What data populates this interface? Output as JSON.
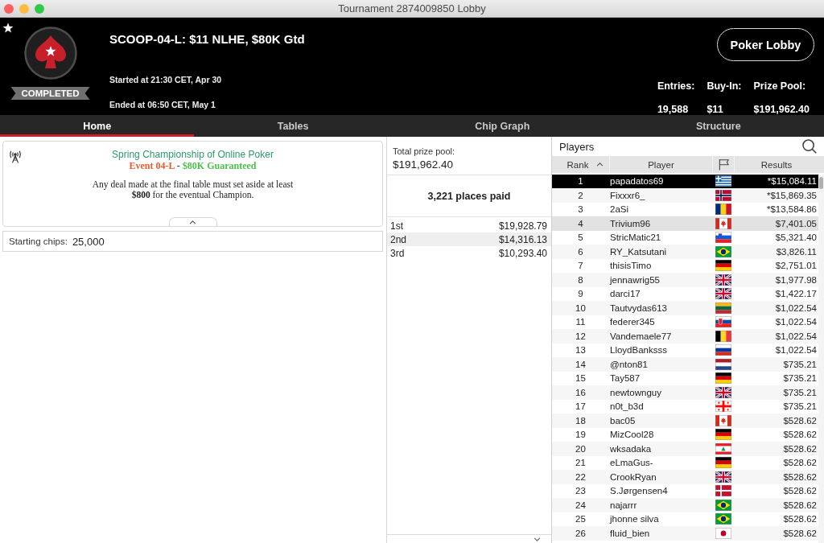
{
  "window": {
    "title": "Tournament 2874009850 Lobby"
  },
  "header": {
    "status": "COMPLETED",
    "title": "SCOOP-04-L: $11 NLHE, $80K Gtd",
    "started": "Started at 21:30 CET, Apr 30",
    "ended": "Ended at 06:50 CET, May 1",
    "lobby_button": "Poker Lobby",
    "stats": [
      {
        "label": "Entries:",
        "value": "19,588"
      },
      {
        "label": "Buy-In:",
        "value": "$11"
      },
      {
        "label": "Prize Pool:",
        "value": "$191,962.40"
      }
    ]
  },
  "tabs": [
    {
      "label": "Home",
      "selected": true
    },
    {
      "label": "Tables",
      "selected": false
    },
    {
      "label": "Chip Graph",
      "selected": false
    },
    {
      "label": "Structure",
      "selected": false
    }
  ],
  "home": {
    "announcement": {
      "heading": "Spring Championship of Online Poker",
      "event_line": [
        {
          "text": "Event 04-L",
          "color": "#ef5b2b"
        },
        {
          "text": "-"
        },
        {
          "text": "$80K Guaranteed",
          "color": "#4cc24c"
        }
      ],
      "body": "Any deal made at the final table must set aside at least **$800** for the eventual Champion.",
      "expanded": true
    },
    "starting_chips": {
      "label": "Starting chips:",
      "value": "25,000"
    }
  },
  "prize_pool": {
    "total_label": "Total prize pool:",
    "total": "$191,962.40",
    "places_paid": "3,221 places paid",
    "rows": [
      {
        "place": "1st",
        "amount": "$19,928.79"
      },
      {
        "place": "2nd",
        "amount": "$14,316.13"
      },
      {
        "place": "3rd",
        "amount": "$10,293.40"
      }
    ]
  },
  "players": {
    "title": "Players",
    "columns": [
      {
        "kind": "text",
        "label": "Rank",
        "sorted": true
      },
      {
        "kind": "text",
        "label": "Player",
        "sorted": false
      },
      {
        "kind": "flag",
        "sorted": false
      },
      {
        "kind": "text",
        "label": "Results",
        "sorted": false
      }
    ],
    "rows": [
      {
        "rank": "1",
        "player": "papadatos69",
        "kind": "greece",
        "result": "*$15,084.11",
        "selected": true,
        "highlighted": false
      },
      {
        "rank": "2",
        "player": "Fixxxr6_",
        "kind": "norway",
        "result": "*$15,869.35",
        "selected": false,
        "highlighted": false
      },
      {
        "rank": "3",
        "player": "2aSi",
        "kind": "romania",
        "result": "*$13,584.86",
        "selected": false,
        "highlighted": false
      },
      {
        "rank": "4",
        "player": "Trivium96",
        "kind": "canada",
        "result": "$7,401.05",
        "selected": false,
        "highlighted": true
      },
      {
        "rank": "5",
        "player": "StricMatic21",
        "kind": "slovenia",
        "result": "$5,321.40",
        "selected": false,
        "highlighted": false
      },
      {
        "rank": "6",
        "player": "RY_Katsutani",
        "kind": "brazil",
        "result": "$3,826.11",
        "selected": false,
        "highlighted": false
      },
      {
        "rank": "7",
        "player": "thisisTimo",
        "kind": "germany",
        "result": "$2,751.01",
        "selected": false,
        "highlighted": false
      },
      {
        "rank": "8",
        "player": "jennawrig55",
        "kind": "uk",
        "result": "$1,977.98",
        "selected": false,
        "highlighted": false
      },
      {
        "rank": "9",
        "player": "darci17",
        "kind": "uk",
        "result": "$1,422.17",
        "selected": false,
        "highlighted": false
      },
      {
        "rank": "10",
        "player": "Tautvydas613",
        "kind": "lithuania",
        "result": "$1,022.54",
        "selected": false,
        "highlighted": false
      },
      {
        "rank": "11",
        "player": "federer345",
        "kind": "slovakia",
        "result": "$1,022.54",
        "selected": false,
        "highlighted": false
      },
      {
        "rank": "12",
        "player": "Vandemaele77",
        "kind": "belgium",
        "result": "$1,022.54",
        "selected": false,
        "highlighted": false
      },
      {
        "rank": "13",
        "player": "LloydBanksss",
        "kind": "russia",
        "result": "$1,022.54",
        "selected": false,
        "highlighted": false
      },
      {
        "rank": "14",
        "player": "@nton81",
        "kind": "netherlands",
        "result": "$735.21",
        "selected": false,
        "highlighted": false
      },
      {
        "rank": "15",
        "player": "Tay587",
        "kind": "germany",
        "result": "$735.21",
        "selected": false,
        "highlighted": false
      },
      {
        "rank": "16",
        "player": "newtownguy",
        "kind": "uk",
        "result": "$735.21",
        "selected": false,
        "highlighted": false
      },
      {
        "rank": "17",
        "player": "n0t_b3d",
        "kind": "georgia",
        "result": "$735.21",
        "selected": false,
        "highlighted": false
      },
      {
        "rank": "18",
        "player": "bac05",
        "kind": "canada",
        "result": "$528.62",
        "selected": false,
        "highlighted": false
      },
      {
        "rank": "19",
        "player": "MizCool28",
        "kind": "germany",
        "result": "$528.62",
        "selected": false,
        "highlighted": false
      },
      {
        "rank": "20",
        "player": "wksadaka",
        "kind": "lebanon",
        "result": "$528.62",
        "selected": false,
        "highlighted": false
      },
      {
        "rank": "21",
        "player": "eLmaGus-",
        "kind": "germany",
        "result": "$528.62",
        "selected": false,
        "highlighted": false
      },
      {
        "rank": "22",
        "player": "CrookRyan",
        "kind": "uk",
        "result": "$528.62",
        "selected": false,
        "highlighted": false
      },
      {
        "rank": "23",
        "player": "S.Jørgensen4",
        "kind": "denmark",
        "result": "$528.62",
        "selected": false,
        "highlighted": false
      },
      {
        "rank": "24",
        "player": "najarrr",
        "kind": "brazil",
        "result": "$528.62",
        "selected": false,
        "highlighted": false
      },
      {
        "rank": "25",
        "player": "jhonne silva",
        "kind": "brazil",
        "result": "$528.62",
        "selected": false,
        "highlighted": false
      },
      {
        "rank": "26",
        "player": "fluid_bien",
        "kind": "japan",
        "result": "$528.62",
        "selected": false,
        "highlighted": false
      }
    ]
  }
}
